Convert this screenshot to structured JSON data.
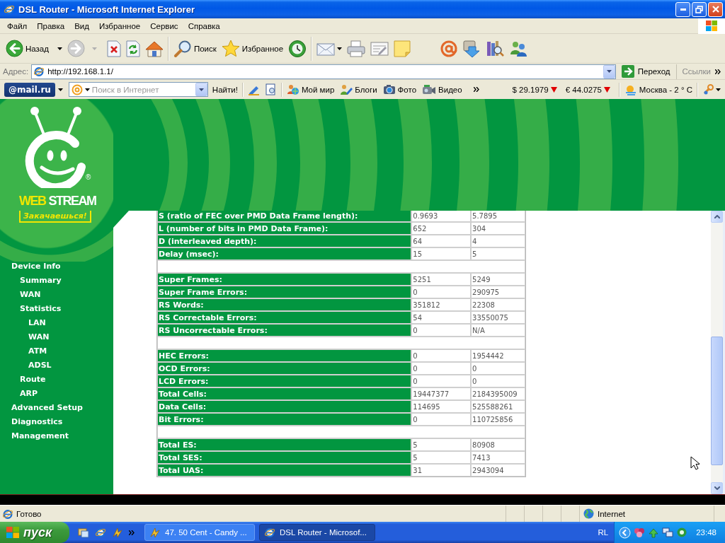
{
  "window": {
    "title": "DSL Router - Microsoft Internet Explorer"
  },
  "menu": [
    "Файл",
    "Правка",
    "Вид",
    "Избранное",
    "Сервис",
    "Справка"
  ],
  "toolbar": {
    "back_label": "Назад",
    "forward_disabled": true,
    "search_label": "Поиск",
    "favorites_label": "Избранное"
  },
  "address_bar": {
    "label": "Адрес:",
    "url": "http://192.168.1.1/",
    "go_label": "Переход",
    "links_label": "Ссылки"
  },
  "mailru_bar": {
    "logo": "@mail.ru",
    "search_placeholder": "Поиск в Интернет",
    "search_button": "Найти!",
    "links": [
      "Мой мир",
      "Блоги",
      "Фото",
      "Видео"
    ],
    "rates": [
      {
        "text": "$ 29.1979",
        "falling": true
      },
      {
        "text": "€ 44.0275",
        "falling": true
      }
    ],
    "weather": "Москва - 2 ° C"
  },
  "logo": {
    "brand_first": "WEB",
    "brand_second": "STREAM",
    "registered": "®",
    "slogan": "Закачаешься!"
  },
  "sidebar": {
    "items": [
      {
        "label": "Device Info",
        "children": [
          {
            "label": "Summary"
          },
          {
            "label": "WAN"
          },
          {
            "label": "Statistics",
            "children": [
              {
                "label": "LAN"
              },
              {
                "label": "WAN"
              },
              {
                "label": "ATM"
              },
              {
                "label": "ADSL"
              }
            ]
          },
          {
            "label": "Route"
          },
          {
            "label": "ARP"
          }
        ]
      },
      {
        "label": "Advanced Setup"
      },
      {
        "label": "Diagnostics"
      },
      {
        "label": "Management"
      }
    ]
  },
  "table": {
    "sections": [
      {
        "rows": [
          {
            "label": "S (ratio of FEC over PMD Data Frame length):",
            "values": [
              "0.9693",
              "5.7895"
            ]
          },
          {
            "label": "L (number of bits in PMD Data Frame):",
            "values": [
              "652",
              "304"
            ]
          },
          {
            "label": "D (interleaved depth):",
            "values": [
              "64",
              "4"
            ]
          },
          {
            "label": "Delay (msec):",
            "values": [
              "15",
              "5"
            ]
          }
        ]
      },
      {
        "rows": [
          {
            "label": "Super Frames:",
            "values": [
              "5251",
              "5249"
            ]
          },
          {
            "label": "Super Frame Errors:",
            "values": [
              "0",
              "290975"
            ]
          },
          {
            "label": "RS Words:",
            "values": [
              "351812",
              "22308"
            ]
          },
          {
            "label": "RS Correctable Errors:",
            "values": [
              "54",
              "33550075"
            ]
          },
          {
            "label": "RS Uncorrectable Errors:",
            "values": [
              "0",
              "N/A"
            ]
          }
        ]
      },
      {
        "rows": [
          {
            "label": "HEC Errors:",
            "values": [
              "0",
              "1954442"
            ]
          },
          {
            "label": "OCD Errors:",
            "values": [
              "0",
              "0"
            ]
          },
          {
            "label": "LCD Errors:",
            "values": [
              "0",
              "0"
            ]
          },
          {
            "label": "Total Cells:",
            "values": [
              "19447377",
              "2184395009"
            ]
          },
          {
            "label": "Data Cells:",
            "values": [
              "114695",
              "525588261"
            ]
          },
          {
            "label": "Bit Errors:",
            "values": [
              "0",
              "110725856"
            ]
          }
        ]
      },
      {
        "rows": [
          {
            "label": "Total ES:",
            "values": [
              "5",
              "80908"
            ]
          },
          {
            "label": "Total SES:",
            "values": [
              "5",
              "7413"
            ]
          },
          {
            "label": "Total UAS:",
            "values": [
              "31",
              "2943094"
            ]
          }
        ]
      }
    ]
  },
  "status_bar": {
    "text": "Готово",
    "zone": "Internet"
  },
  "taskbar": {
    "start_label": "пуск",
    "tasks": [
      {
        "label": "47. 50 Cent - Candy ...",
        "selected": false
      },
      {
        "label": "DSL Router - Microsof...",
        "selected": true
      }
    ],
    "language": "RL",
    "clock": "23:48"
  }
}
